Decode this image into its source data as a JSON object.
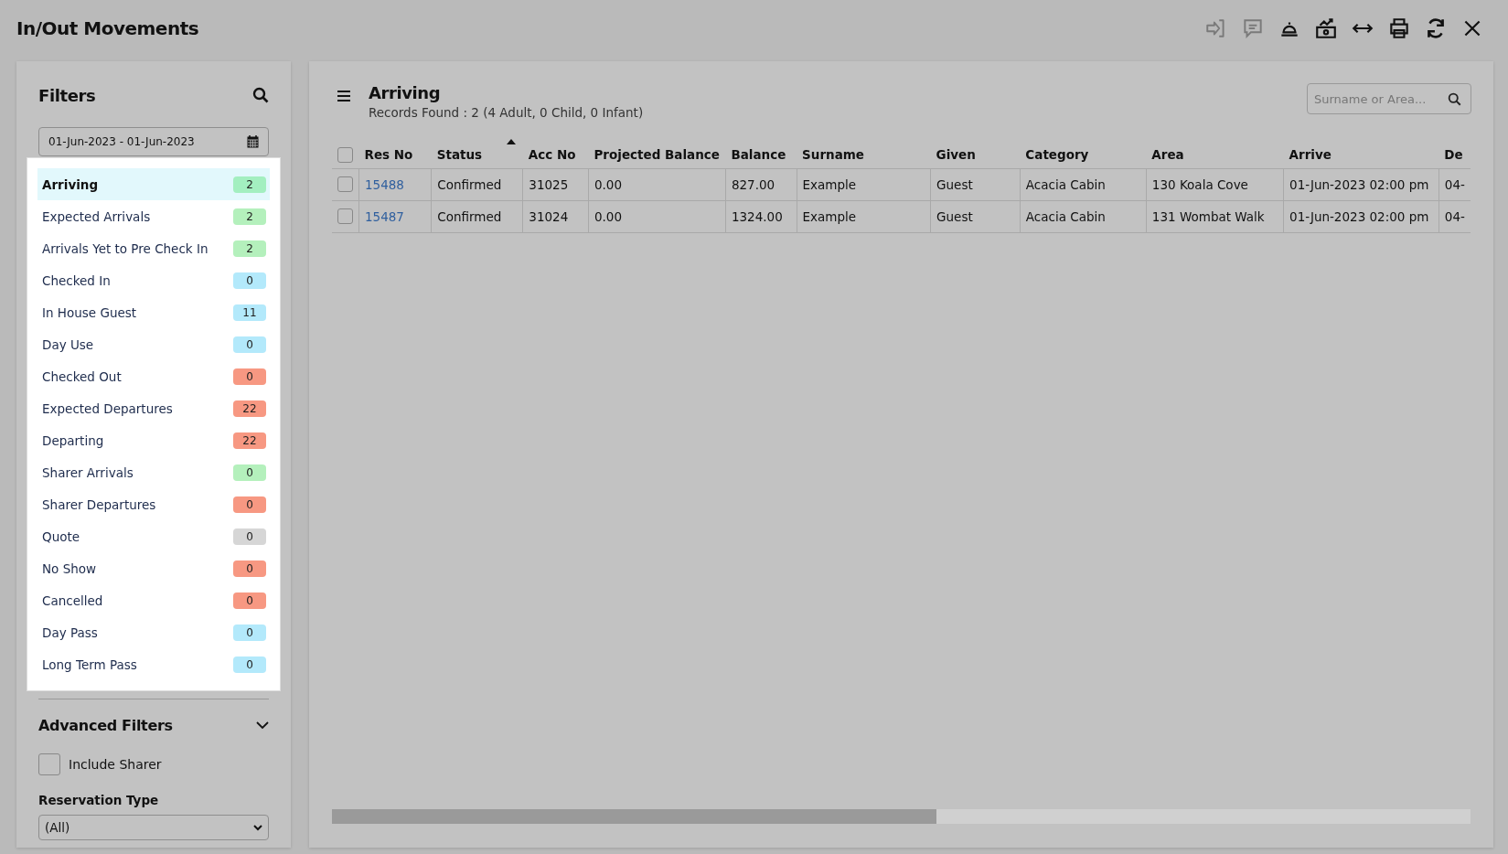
{
  "window": {
    "title": "In/Out Movements"
  },
  "toolbar": [
    {
      "kind": "sign-in",
      "disabled": true
    },
    {
      "kind": "comment",
      "disabled": true
    },
    {
      "kind": "bell",
      "disabled": false
    },
    {
      "kind": "cash-chart",
      "disabled": false
    },
    {
      "kind": "arrows",
      "disabled": false
    },
    {
      "kind": "print",
      "disabled": false
    },
    {
      "kind": "refresh",
      "disabled": false
    },
    {
      "kind": "close",
      "disabled": false
    }
  ],
  "filters": {
    "title": "Filters",
    "date_range": "01-Jun-2023 - 01-Jun-2023",
    "items": [
      {
        "label": "Arriving",
        "count": "2",
        "color": "#a3efc0",
        "selected": true
      },
      {
        "label": "Expected Arrivals",
        "count": "2",
        "color": "#b4f0bc",
        "selected": false
      },
      {
        "label": "Arrivals Yet to Pre Check In",
        "count": "2",
        "color": "#b4f0bc",
        "selected": false
      },
      {
        "label": "Checked In",
        "count": "0",
        "color": "#b3e9fb",
        "selected": false
      },
      {
        "label": "In House Guest",
        "count": "11",
        "color": "#b3e9fb",
        "selected": false
      },
      {
        "label": "Day Use",
        "count": "0",
        "color": "#b3e9fb",
        "selected": false
      },
      {
        "label": "Checked Out",
        "count": "0",
        "color": "#f79882",
        "selected": false
      },
      {
        "label": "Expected Departures",
        "count": "22",
        "color": "#f79882",
        "selected": false
      },
      {
        "label": "Departing",
        "count": "22",
        "color": "#f79882",
        "selected": false
      },
      {
        "label": "Sharer Arrivals",
        "count": "0",
        "color": "#b4f0bc",
        "selected": false
      },
      {
        "label": "Sharer Departures",
        "count": "0",
        "color": "#f79882",
        "selected": false
      },
      {
        "label": "Quote",
        "count": "0",
        "color": "#d6d6d6",
        "selected": false
      },
      {
        "label": "No Show",
        "count": "0",
        "color": "#f79882",
        "selected": false
      },
      {
        "label": "Cancelled",
        "count": "0",
        "color": "#f79882",
        "selected": false
      },
      {
        "label": "Day Pass",
        "count": "0",
        "color": "#b3e9fb",
        "selected": false
      },
      {
        "label": "Long Term Pass",
        "count": "0",
        "color": "#b3e9fb",
        "selected": false
      }
    ],
    "advanced": {
      "title": "Advanced Filters",
      "include_sharer": {
        "label": "Include Sharer",
        "checked": false
      },
      "reservation_type": {
        "label": "Reservation Type",
        "value": "(All)"
      }
    }
  },
  "main": {
    "title": "Arriving",
    "records": "Records Found : 2 (4 Adult, 0 Child, 0 Infant)",
    "search": {
      "placeholder": "Surname or Area..."
    },
    "table": {
      "header_checked": false,
      "columns": [
        {
          "label": "Res No",
          "sorted": false
        },
        {
          "label": "Status",
          "sorted": true
        },
        {
          "label": "Acc No",
          "sorted": false
        },
        {
          "label": "Projected Balance",
          "sorted": false
        },
        {
          "label": "Balance",
          "sorted": false
        },
        {
          "label": "Surname",
          "sorted": false
        },
        {
          "label": "Given",
          "sorted": false
        },
        {
          "label": "Category",
          "sorted": false
        },
        {
          "label": "Area",
          "sorted": false
        },
        {
          "label": "Arrive",
          "sorted": false
        },
        {
          "label": "De",
          "sorted": false
        }
      ],
      "rows": [
        {
          "checked": false,
          "cells": [
            "15488",
            "Confirmed",
            "31025",
            "0.00",
            "827.00",
            "Example",
            "Guest",
            "Acacia Cabin",
            "130 Koala Cove",
            "01-Jun-2023 02:00 pm",
            "04-"
          ]
        },
        {
          "checked": false,
          "cells": [
            "15487",
            "Confirmed",
            "31024",
            "0.00",
            "1324.00",
            "Example",
            "Guest",
            "Acacia Cabin",
            "131 Wombat Walk",
            "01-Jun-2023 02:00 pm",
            "04-"
          ]
        }
      ]
    }
  }
}
